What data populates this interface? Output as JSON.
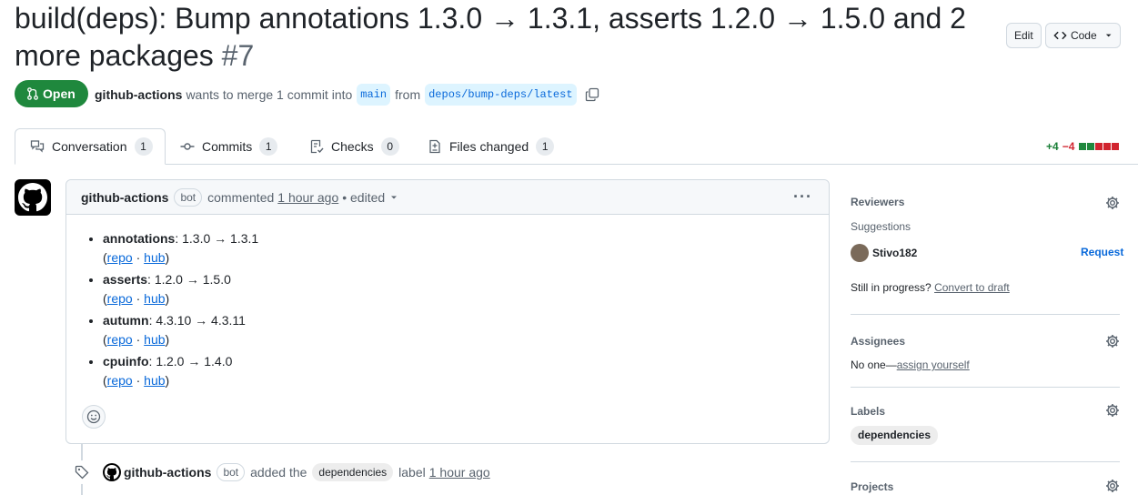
{
  "title": {
    "text": "build(deps): Bump annotations 1.3.0 → 1.3.1, asserts 1.2.0 → 1.5.0 and 2 more packages",
    "number": "#7"
  },
  "header_buttons": {
    "edit": "Edit",
    "code": "Code"
  },
  "meta": {
    "state": "Open",
    "author": "github-actions",
    "merge_text": "wants to merge 1 commit into",
    "base_branch": "main",
    "from_text": "from",
    "head_branch": "depos/bump-deps/latest"
  },
  "tabs": [
    {
      "label": "Conversation",
      "count": "1"
    },
    {
      "label": "Commits",
      "count": "1"
    },
    {
      "label": "Checks",
      "count": "0"
    },
    {
      "label": "Files changed",
      "count": "1"
    }
  ],
  "diffstat": {
    "additions": "+4",
    "deletions": "−4",
    "colors": [
      "#1f883d",
      "#1f883d",
      "#d1242f",
      "#d1242f",
      "#d1242f"
    ]
  },
  "comment": {
    "author": "github-actions",
    "bot_label": "bot",
    "action": "commented",
    "time": "1 hour ago",
    "edited": "• edited",
    "items": [
      {
        "name": "annotations",
        "change": ": 1.3.0 → 1.3.1",
        "repo": "repo",
        "sep": " · ",
        "hub": "hub"
      },
      {
        "name": "asserts",
        "change": ": 1.2.0 → 1.5.0",
        "repo": "repo",
        "sep": " · ",
        "hub": "hub"
      },
      {
        "name": "autumn",
        "change": ": 4.3.10 → 4.3.11",
        "repo": "repo",
        "sep": " · ",
        "hub": "hub"
      },
      {
        "name": "cpuinfo",
        "change": ": 1.2.0 → 1.4.0",
        "repo": "repo",
        "sep": " · ",
        "hub": "hub"
      }
    ]
  },
  "timeline": {
    "author": "github-actions",
    "bot_label": "bot",
    "action": "added the",
    "label": "dependencies",
    "suffix": "label",
    "time": "1 hour ago"
  },
  "sidebar": {
    "reviewers": {
      "heading": "Reviewers",
      "suggestions": "Suggestions",
      "user": "Stivo182",
      "request": "Request",
      "progress_text": "Still in progress?",
      "draft_link": "Convert to draft"
    },
    "assignees": {
      "heading": "Assignees",
      "none": "No one—",
      "assign_link": "assign yourself"
    },
    "labels": {
      "heading": "Labels",
      "label": "dependencies"
    },
    "projects": {
      "heading": "Projects"
    }
  }
}
